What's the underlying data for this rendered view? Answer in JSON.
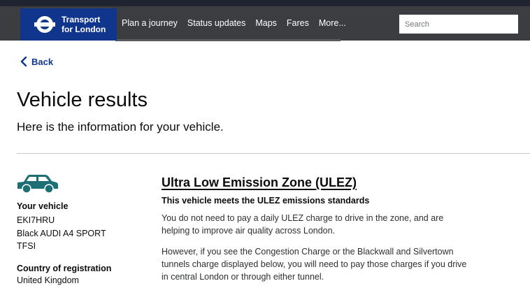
{
  "header": {
    "logo_line1": "Transport",
    "logo_line2": "for London",
    "nav": [
      {
        "label": "Plan a journey"
      },
      {
        "label": "Status updates"
      },
      {
        "label": "Maps"
      },
      {
        "label": "Fares"
      },
      {
        "label": "More..."
      }
    ],
    "search_placeholder": "Search"
  },
  "back_label": "Back",
  "title": "Vehicle results",
  "subtitle": "Here is the information for your vehicle.",
  "vehicle": {
    "label": "Your vehicle",
    "registration": "EKI7HRU",
    "model_line1": "Black AUDI A4 SPORT",
    "model_line2": "TFSI",
    "country_label": "Country of registration",
    "country": "United Kingdom"
  },
  "ulez": {
    "heading": "Ultra Low Emission Zone (ULEZ)",
    "status": "This vehicle meets the ULEZ emissions standards",
    "para1": "You do not need to pay a daily ULEZ charge to drive in the zone, and are helping to improve air quality across London.",
    "para2": "However, if you see the Congestion Charge or the Blackwall and Silvertown tunnels charge displayed below, you will need to pay those charges if you drive in central London or through either tunnel."
  },
  "colors": {
    "brand_blue": "#10358d",
    "header_bg": "#3b3d40",
    "car_teal": "#1e6f73"
  }
}
